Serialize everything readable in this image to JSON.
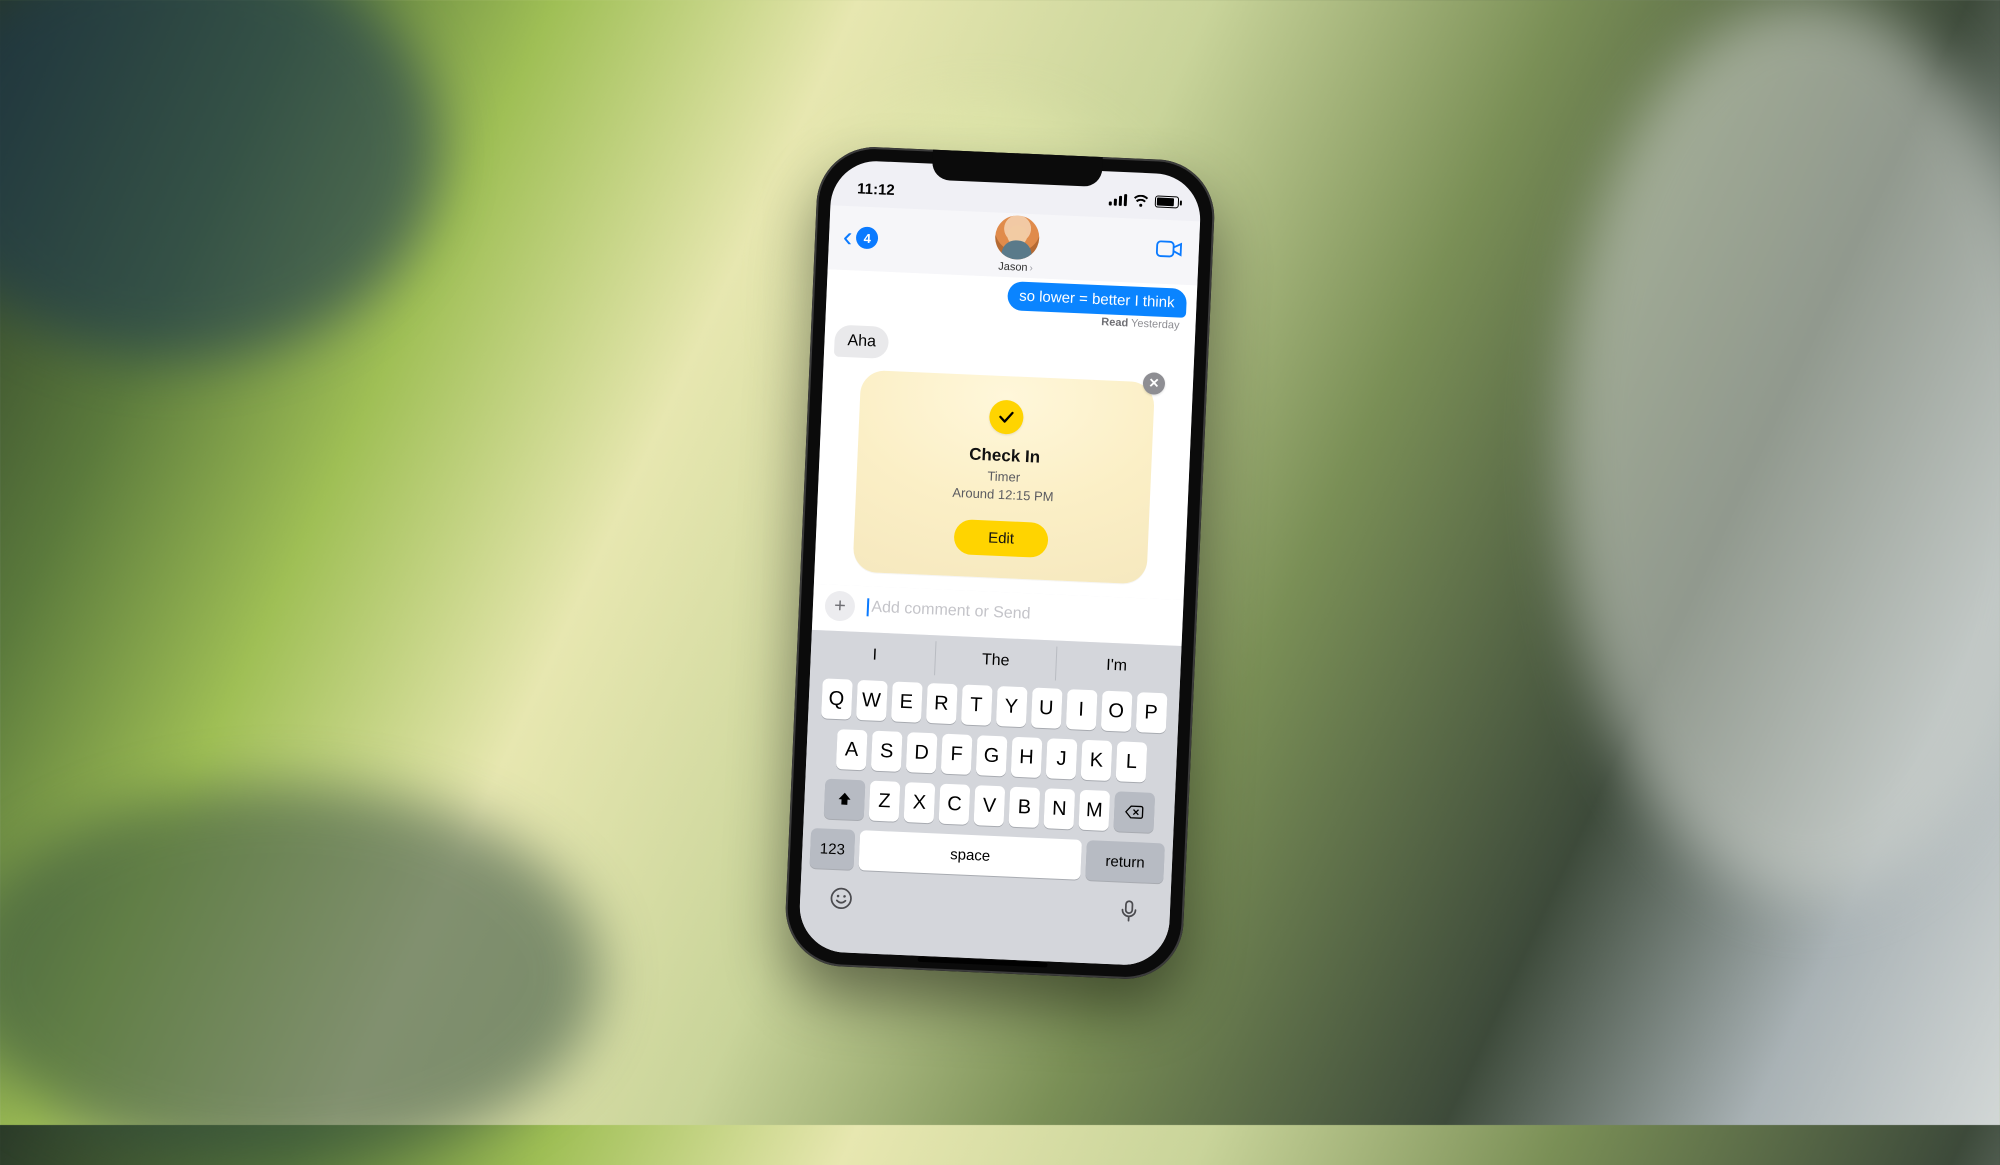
{
  "statusbar": {
    "time": "11:12"
  },
  "nav": {
    "back_count": "4",
    "contact_name": "Jason"
  },
  "messages": {
    "sent_last": "so lower = better I think",
    "read_label": "Read",
    "read_time": "Yesterday",
    "received_1": "Aha"
  },
  "checkin": {
    "title": "Check In",
    "subtitle1": "Timer",
    "subtitle2": "Around 12:15 PM",
    "edit_label": "Edit"
  },
  "compose": {
    "placeholder": "Add comment or Send"
  },
  "predictions": {
    "p1": "I",
    "p2": "The",
    "p3": "I'm"
  },
  "keys": {
    "row1": [
      "Q",
      "W",
      "E",
      "R",
      "T",
      "Y",
      "U",
      "I",
      "O",
      "P"
    ],
    "row2": [
      "A",
      "S",
      "D",
      "F",
      "G",
      "H",
      "J",
      "K",
      "L"
    ],
    "row3": [
      "Z",
      "X",
      "C",
      "V",
      "B",
      "N",
      "M"
    ],
    "num": "123",
    "space": "space",
    "return": "return"
  }
}
